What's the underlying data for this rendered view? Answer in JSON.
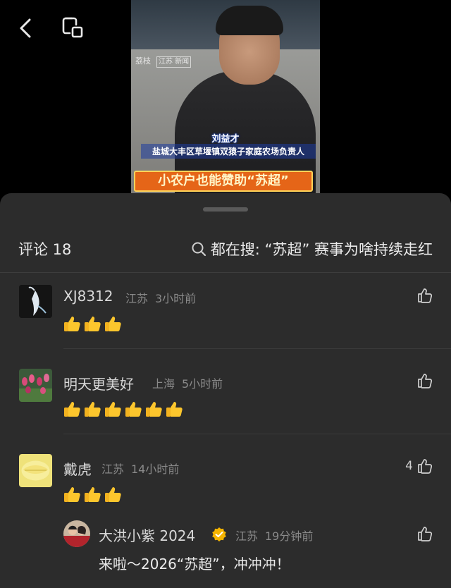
{
  "video": {
    "watermark_left": "荔枝",
    "watermark_right": "江苏 新闻",
    "caption_name": "刘益才",
    "caption_role": "盐城大丰区草堰镇双猿子家庭农场负责人",
    "headline": "小农户也能赞助“苏超”"
  },
  "comments_panel": {
    "count_label": "评论 18",
    "search_hint": "都在搜: “苏超” 赛事为啥持续走红",
    "comments": [
      {
        "name": "XJ8312",
        "location": "江苏",
        "time": "3小时前",
        "thumbs": 3,
        "likes": ""
      },
      {
        "name": "明天更美好",
        "location": "上海",
        "time": "5小时前",
        "thumbs": 6,
        "likes": ""
      },
      {
        "name": "戴虎",
        "location": "江苏",
        "time": "14小时前",
        "thumbs": 3,
        "likes": "4"
      }
    ],
    "reply": {
      "name": "大洪小紫 2024",
      "location": "江苏",
      "time": "19分钟前",
      "text": "来啦～2026“苏超”，冲冲冲！"
    }
  },
  "colors": {
    "sheet_bg": "#2c2c2c",
    "meta_text": "#8a8a8a",
    "verified": "#f5b400"
  }
}
